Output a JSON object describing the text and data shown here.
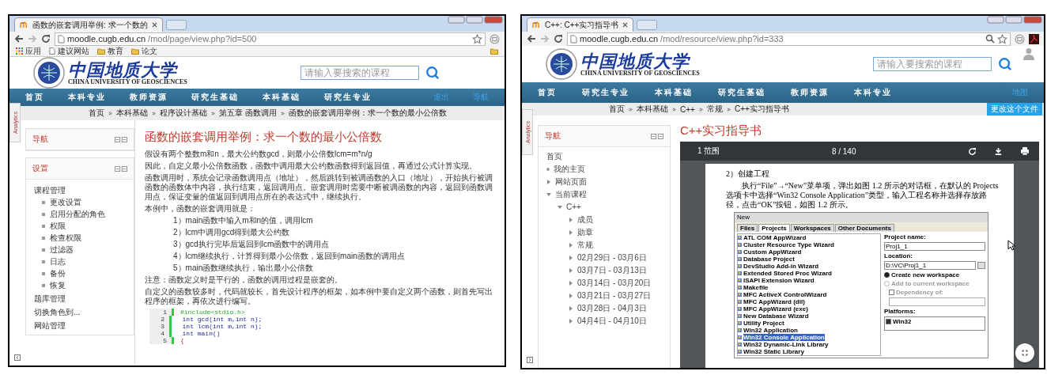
{
  "windows": [
    {
      "kind": "page",
      "tab": {
        "title": "函数的嵌套调用举例: 求一个数的"
      },
      "address": {
        "host": "moodle.cugb.edu.cn",
        "path": "/mod/page/view.php?id=500"
      },
      "bookmarks": [
        {
          "label": "应用",
          "kind": "apps"
        },
        {
          "label": "建议网站",
          "kind": "page"
        },
        {
          "label": "教育",
          "kind": "folder"
        },
        {
          "label": "论文",
          "kind": "folder"
        }
      ],
      "logo": {
        "chinese": "中国地质大学",
        "english": "CHINA UNIVERSITY OF GEOSCIENCES"
      },
      "search": {
        "placeholder": "请输入要搜索的课程"
      },
      "nav": {
        "items": [
          "首页",
          "本科专业",
          "教师资源",
          "研究生基础",
          "本科基础",
          "研究生专业"
        ],
        "links": [
          "退出",
          "导航"
        ]
      },
      "breadcrumb": [
        "首页",
        "本科基础",
        "程序设计基础",
        "第五章 函数调用",
        "函数的嵌套调用举例：求一个数的最小公倍数"
      ],
      "analytics": "Analytics",
      "blocks": [
        {
          "title": "导航"
        },
        {
          "title": "设置",
          "items": [
            {
              "label": "课程管理",
              "kind": "heading"
            },
            {
              "label": "更改设置",
              "kind": "item"
            },
            {
              "label": "启用分配的角色",
              "kind": "item"
            },
            {
              "label": "权限",
              "kind": "item"
            },
            {
              "label": "检查权限",
              "kind": "item"
            },
            {
              "label": "过滤器",
              "kind": "item"
            },
            {
              "label": "日志",
              "kind": "item"
            },
            {
              "label": "备份",
              "kind": "item"
            },
            {
              "label": "恢复",
              "kind": "item"
            },
            {
              "label": "题库管理",
              "kind": "heading"
            },
            {
              "label": "切换角色到...",
              "kind": "heading"
            },
            {
              "label": "网站管理",
              "kind": "heading"
            }
          ]
        }
      ],
      "content": {
        "title": "函数的嵌套调用举例：求一个数的最小公倍数",
        "intro": [
          "假设有两个整数m和n，最大公约数gcd，则最小公倍数lcm=m*n/g",
          "因此，自定义最小公倍数函数，函数中调用最大公约数函数得到返回值，再通过公式计算实现。",
          "函数调用时，系统会记录函数调用点（地址），然后跳转到被调函数的入口（地址），开始执行被调函数的函数体中内容，执行结束，返回调用点。嵌套调用时需要中断被调函数的内容，返回到函数调用点，保证变量的值返回到调用点所在的表达式中，继续执行。",
          "本例中，函数的嵌套调用就是："
        ],
        "steps": [
          "1）main函数中输入m和n的值，调用lcm",
          "2）lcm中调用gcd得到最大公约数",
          "3）gcd执行完毕后返回到lcm函数中的调用点",
          "4）lcm继续执行，计算得到最小公倍数，返回到main函数的调用点",
          "5）main函数继续执行，输出最小公倍数"
        ],
        "notes": [
          "注意：函数定义时是平行的，函数的调用过程是嵌套的。",
          "自定义的函数较多时，代码就较长，首先设计程序的框架，如本例中要自定义两个函数，则首先写出程序的框架，再依次进行编写。"
        ],
        "code": [
          {
            "number": "1",
            "text": "#include<stdio.h>",
            "kind": "directive",
            "modified": false
          },
          {
            "number": "2",
            "text": "int gcd(int m,int n);",
            "kind": "code",
            "modified": false
          },
          {
            "number": "3",
            "text": "int lcm(int m,int n);",
            "kind": "code",
            "modified": false
          },
          {
            "number": "4",
            "text": "int main()",
            "kind": "code",
            "modified": false
          },
          {
            "number": "5",
            "text": "{",
            "kind": "brace",
            "modified": false
          }
        ]
      }
    },
    {
      "kind": "resource",
      "tab": {
        "title": "C++: C++实习指导书"
      },
      "address": {
        "host": "moodle.cugb.edu.cn",
        "path": "/mod/resource/view.php?id=333"
      },
      "logo": {
        "chinese": "中国地质大学",
        "english": "CHINA UNIVERSITY OF GEOSCIENCES"
      },
      "search": {
        "placeholder": "请输入要搜索的课程"
      },
      "nav": {
        "items": [
          "首页",
          "研究生专业",
          "本科基础",
          "研究生基础",
          "教师资源",
          "本科专业"
        ],
        "links": [
          "地图"
        ]
      },
      "breadcrumb": [
        "首页",
        "本科基础",
        "C++",
        "常规",
        "C++实习指导书"
      ],
      "edit_button": "更改这个文件",
      "analytics": "Analytics",
      "sidebar": {
        "title": "导航",
        "items": [
          {
            "label": "首页",
            "kind": "heading"
          },
          {
            "label": "我的主页",
            "kind": "leaf"
          },
          {
            "label": "网站页面",
            "kind": "branch",
            "expanded": false
          },
          {
            "label": "当前课程",
            "kind": "branch",
            "expanded": true,
            "children": [
              {
                "label": "C++",
                "kind": "branch",
                "expanded": true,
                "children": [
                  {
                    "label": "成员",
                    "kind": "branch",
                    "expanded": false
                  },
                  {
                    "label": "勋章",
                    "kind": "branch",
                    "expanded": false
                  },
                  {
                    "label": "常规",
                    "kind": "branch",
                    "expanded": false
                  },
                  {
                    "label": "02月29日 - 03月6日",
                    "kind": "branch",
                    "expanded": false
                  },
                  {
                    "label": "03月7日 - 03月13日",
                    "kind": "branch",
                    "expanded": false
                  },
                  {
                    "label": "03月14日 - 03月20日",
                    "kind": "branch",
                    "expanded": false
                  },
                  {
                    "label": "03月21日 - 03月27日",
                    "kind": "branch",
                    "expanded": false
                  },
                  {
                    "label": "03月28日 - 04月3日",
                    "kind": "branch",
                    "expanded": false
                  },
                  {
                    "label": "04月4日 - 04月10日",
                    "kind": "branch",
                    "expanded": false
                  }
                ]
              }
            ]
          }
        ]
      },
      "content": {
        "title": "C++实习指导书",
        "viewer": {
          "outline": "1 范围",
          "page_indicator": "8 / 140",
          "doc": {
            "heading": "2）创建工程",
            "paragraph": "执行“File”→“New”菜单项，弹出如图 1.2 所示的对话框，在默认的 Projects 选项卡中选择“Win32 Console Application”类型，输入工程名称并选择存放路径，点击“OK”按钮，如图 1.2 所示。",
            "dialog": {
              "title": "New",
              "tabs": [
                {
                  "label": "Files",
                  "selected": false
                },
                {
                  "label": "Projects",
                  "selected": true
                },
                {
                  "label": "Workspaces",
                  "selected": false
                },
                {
                  "label": "Other Documents",
                  "selected": false
                }
              ],
              "project_types": [
                {
                  "label": "ATL COM AppWizard",
                  "selected": false
                },
                {
                  "label": "Cluster Resource Type Wizard",
                  "selected": false
                },
                {
                  "label": "Custom AppWizard",
                  "selected": false
                },
                {
                  "label": "Database Project",
                  "selected": false
                },
                {
                  "label": "DevStudio Add-in Wizard",
                  "selected": false
                },
                {
                  "label": "Extended Stored Proc Wizard",
                  "selected": false
                },
                {
                  "label": "ISAPI Extension Wizard",
                  "selected": false
                },
                {
                  "label": "Makefile",
                  "selected": false
                },
                {
                  "label": "MFC ActiveX ControlWizard",
                  "selected": false
                },
                {
                  "label": "MFC AppWizard (dll)",
                  "selected": false
                },
                {
                  "label": "MFC AppWizard (exe)",
                  "selected": false
                },
                {
                  "label": "New Database Wizard",
                  "selected": false
                },
                {
                  "label": "Utility Project",
                  "selected": false
                },
                {
                  "label": "Win32 Application",
                  "selected": false
                },
                {
                  "label": "Win32 Console Application",
                  "selected": true
                },
                {
                  "label": "Win32 Dynamic-Link Library",
                  "selected": false
                },
                {
                  "label": "Win32 Static Library",
                  "selected": false
                }
              ],
              "project_name": {
                "label": "Project name:",
                "value": "Proj1_1"
              },
              "location": {
                "label": "Location:",
                "value": "D:\\VC\\Proj1_1"
              },
              "workspace_options": [
                {
                  "label": "Create new workspace",
                  "selected": true,
                  "disabled": false
                },
                {
                  "label": "Add to current workspace",
                  "selected": false,
                  "disabled": true
                }
              ],
              "dependency": {
                "label": "Dependency of:",
                "checked": false
              },
              "platforms": {
                "label": "Platforms:",
                "items": [
                  {
                    "label": "Win32",
                    "checked": true
                  }
                ]
              }
            }
          }
        }
      }
    }
  ]
}
